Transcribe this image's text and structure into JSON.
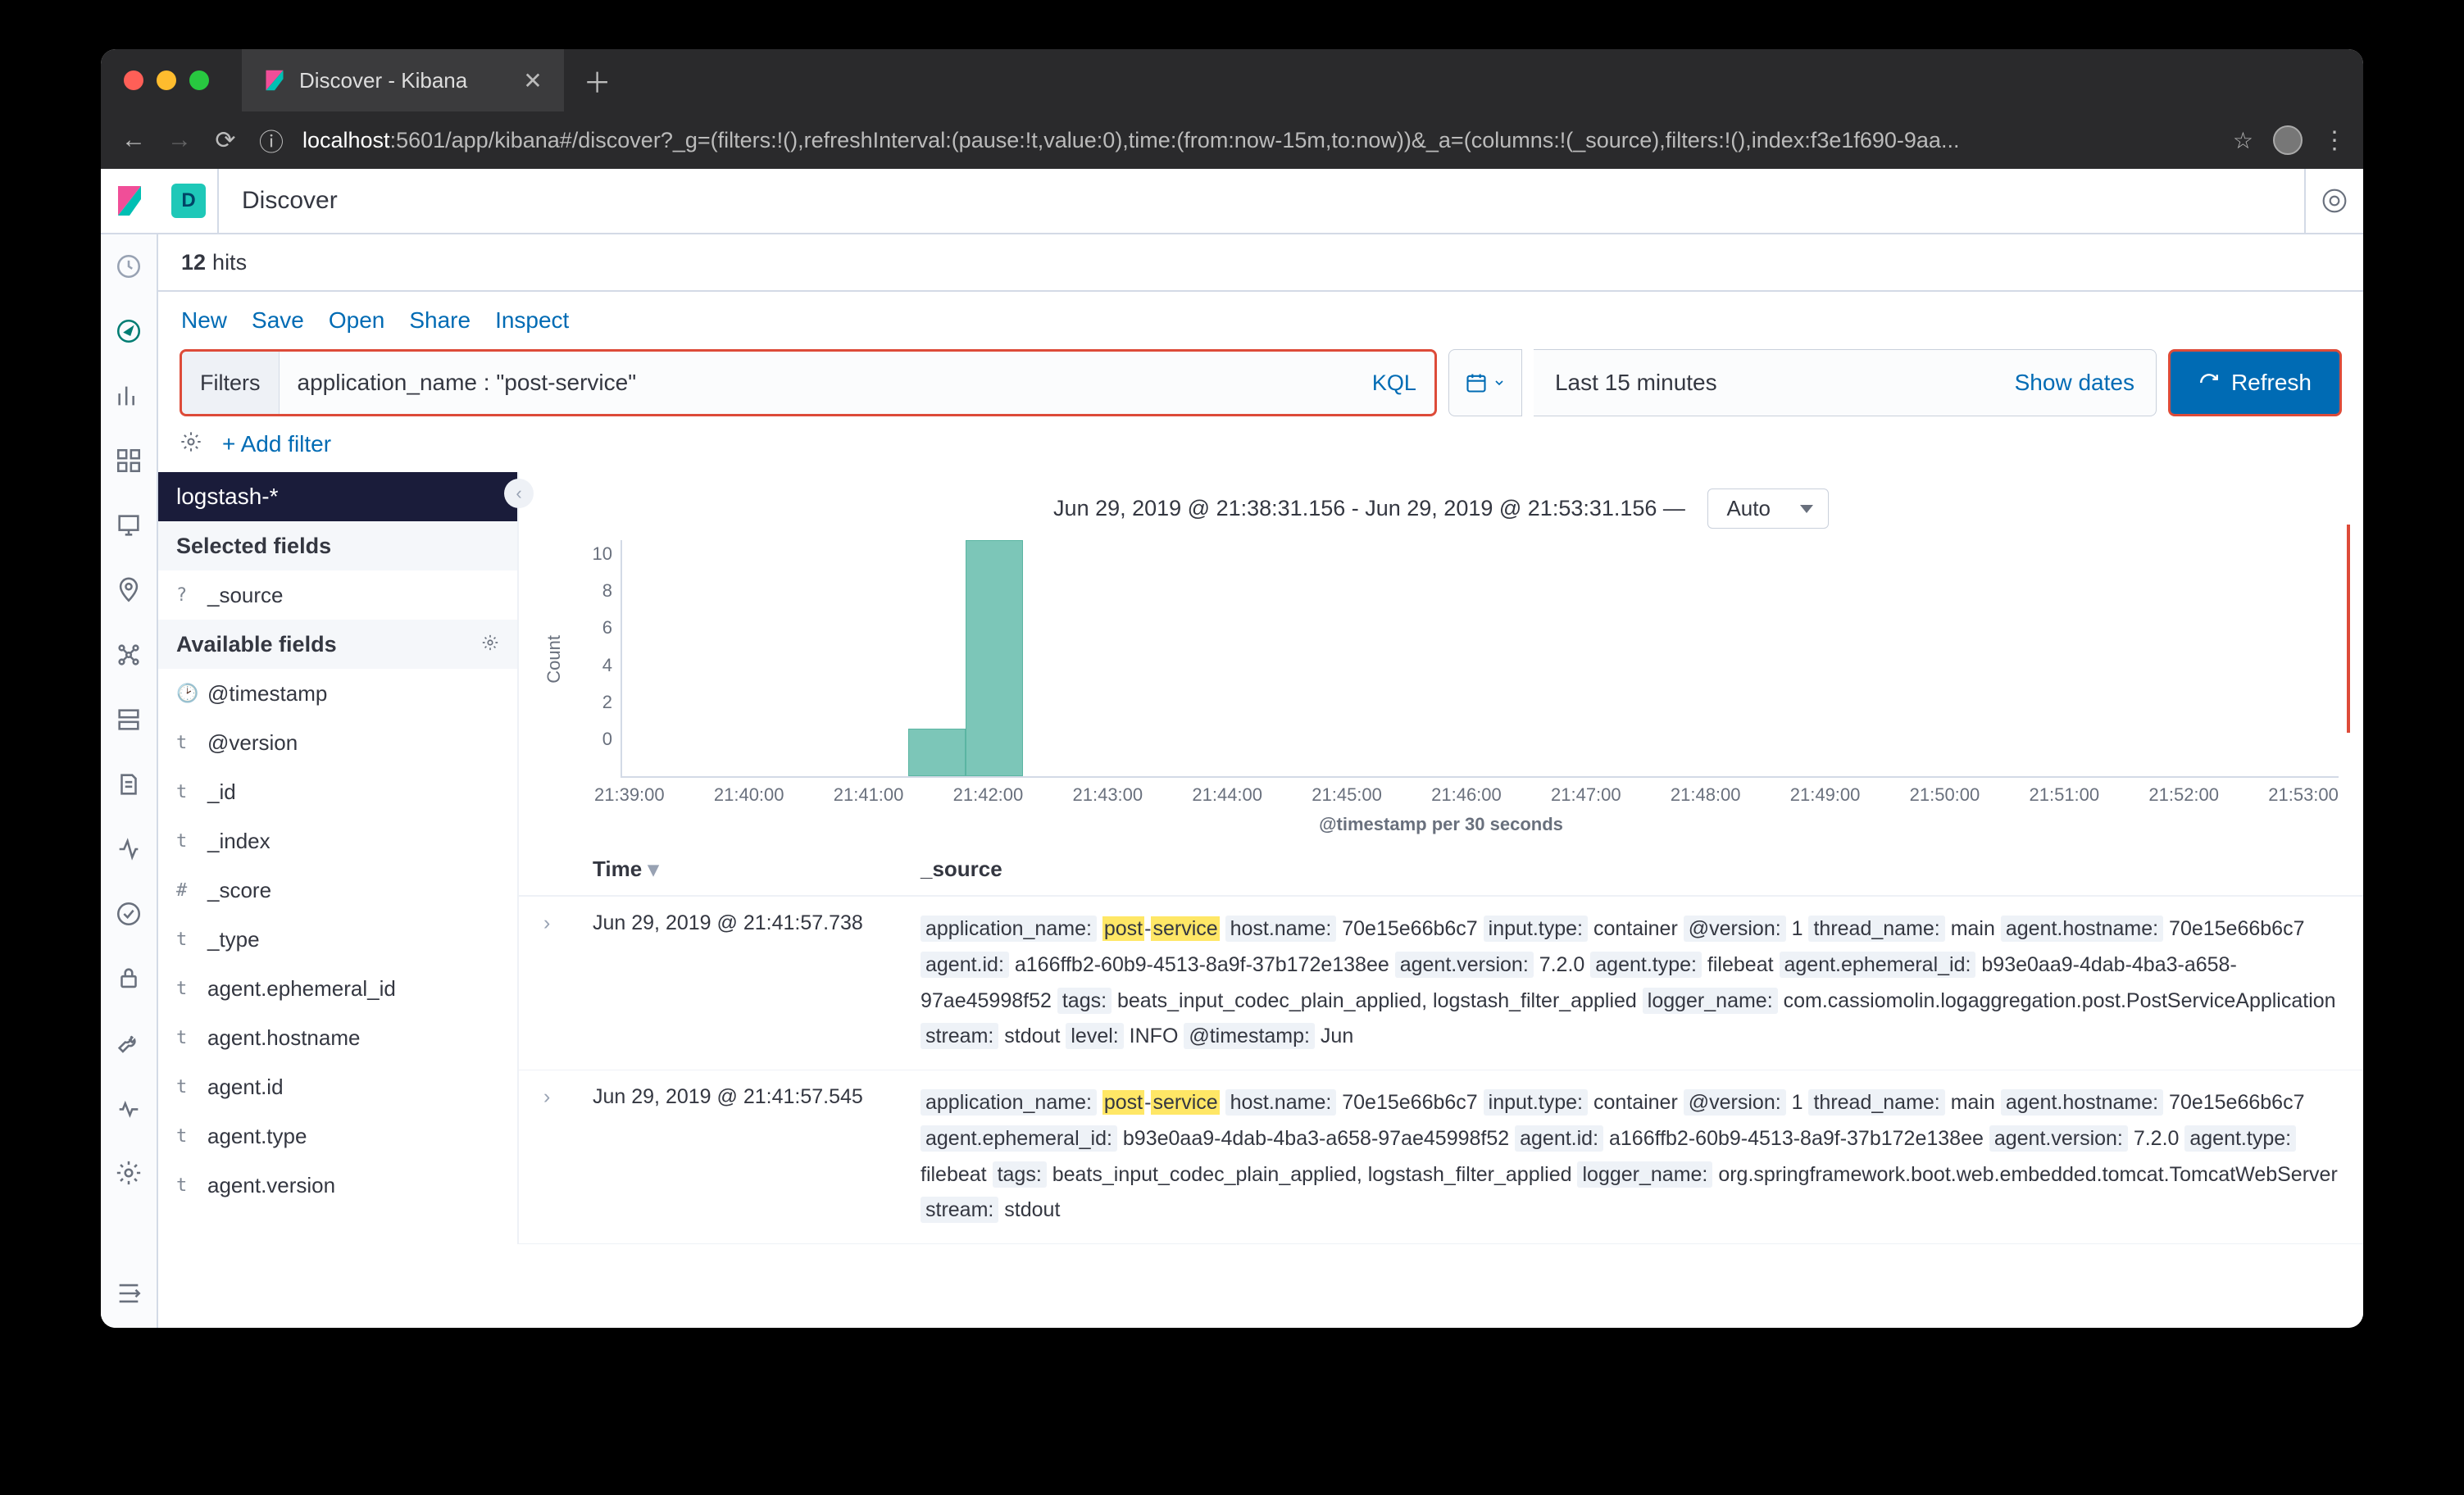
{
  "browser": {
    "tab_title": "Discover - Kibana",
    "url_host": "localhost",
    "url_path": ":5601/app/kibana#/discover?_g=(filters:!(),refreshInterval:(pause:!t,value:0),time:(from:now-15m,to:now))&_a=(columns:!(_source),filters:!(),index:f3e1f690-9aa..."
  },
  "header": {
    "space_letter": "D",
    "breadcrumb": "Discover"
  },
  "hits": {
    "count": "12",
    "label": "hits"
  },
  "menu": {
    "new": "New",
    "save": "Save",
    "open": "Open",
    "share": "Share",
    "inspect": "Inspect"
  },
  "search": {
    "filters_label": "Filters",
    "query": "application_name : \"post-service\"",
    "kql": "KQL",
    "time_range": "Last 15 minutes",
    "show_dates": "Show dates",
    "refresh": "Refresh",
    "add_filter": "+ Add filter"
  },
  "sidebar": {
    "index": "logstash-*",
    "selected_label": "Selected fields",
    "available_label": "Available fields",
    "selected": [
      {
        "t": "?",
        "n": "_source"
      }
    ],
    "available": [
      {
        "t": "🕑",
        "n": "@timestamp"
      },
      {
        "t": "t",
        "n": "@version"
      },
      {
        "t": "t",
        "n": "_id"
      },
      {
        "t": "t",
        "n": "_index"
      },
      {
        "t": "#",
        "n": "_score"
      },
      {
        "t": "t",
        "n": "_type"
      },
      {
        "t": "t",
        "n": "agent.ephemeral_id"
      },
      {
        "t": "t",
        "n": "agent.hostname"
      },
      {
        "t": "t",
        "n": "agent.id"
      },
      {
        "t": "t",
        "n": "agent.type"
      },
      {
        "t": "t",
        "n": "agent.version"
      }
    ]
  },
  "chart_data": {
    "type": "bar",
    "title": "Jun 29, 2019 @ 21:38:31.156 - Jun 29, 2019 @ 21:53:31.156 —",
    "auto": "Auto",
    "ylabel": "Count",
    "xlabel": "@timestamp per 30 seconds",
    "ylim": [
      0,
      10
    ],
    "yticks": [
      0,
      2,
      4,
      6,
      8,
      10
    ],
    "xticks": [
      "21:39:00",
      "21:40:00",
      "21:41:00",
      "21:42:00",
      "21:43:00",
      "21:44:00",
      "21:45:00",
      "21:46:00",
      "21:47:00",
      "21:48:00",
      "21:49:00",
      "21:50:00",
      "21:51:00",
      "21:52:00",
      "21:53:00"
    ],
    "bars": [
      {
        "x_index": 5,
        "value": 2
      },
      {
        "x_index": 6,
        "value": 10
      }
    ]
  },
  "table": {
    "h_time": "Time",
    "h_source": "_source",
    "rows": [
      {
        "ts": "Jun 29, 2019 @ 21:41:57.738",
        "src": [
          [
            "application_name:",
            "post",
            "-",
            "service"
          ],
          [
            "host.name:",
            "70e15e66b6c7"
          ],
          [
            "input.type:",
            "container"
          ],
          [
            "@version:",
            "1"
          ],
          [
            "thread_name:",
            "main"
          ],
          [
            "agent.hostname:",
            "70e15e66b6c7"
          ],
          [
            "agent.id:",
            "a166ffb2-60b9-4513-8a9f-37b172e138ee"
          ],
          [
            "agent.version:",
            "7.2.0"
          ],
          [
            "agent.type:",
            "filebeat"
          ],
          [
            "agent.ephemeral_id:",
            "b93e0aa9-4dab-4ba3-a658-97ae45998f52"
          ],
          [
            "tags:",
            "beats_input_codec_plain_applied, logstash_filter_applied"
          ],
          [
            "logger_name:",
            "com.cassiomolin.logaggregation.post.PostServiceApplication"
          ],
          [
            "stream:",
            "stdout"
          ],
          [
            "level:",
            "INFO"
          ],
          [
            "@timestamp:",
            "Jun"
          ]
        ]
      },
      {
        "ts": "Jun 29, 2019 @ 21:41:57.545",
        "src": [
          [
            "application_name:",
            "post",
            "-",
            "service"
          ],
          [
            "host.name:",
            "70e15e66b6c7"
          ],
          [
            "input.type:",
            "container"
          ],
          [
            "@version:",
            "1"
          ],
          [
            "thread_name:",
            "main"
          ],
          [
            "agent.hostname:",
            "70e15e66b6c7"
          ],
          [
            "agent.ephemeral_id:",
            "b93e0aa9-4dab-4ba3-a658-97ae45998f52"
          ],
          [
            "agent.id:",
            "a166ffb2-60b9-4513-8a9f-37b172e138ee"
          ],
          [
            "agent.version:",
            "7.2.0"
          ],
          [
            "agent.type:",
            "filebeat"
          ],
          [
            "tags:",
            "beats_input_codec_plain_applied, logstash_filter_applied"
          ],
          [
            "logger_name:",
            "org.springframework.boot.web.embedded.tomcat.TomcatWebServer"
          ],
          [
            "stream:",
            "stdout"
          ]
        ]
      }
    ]
  }
}
